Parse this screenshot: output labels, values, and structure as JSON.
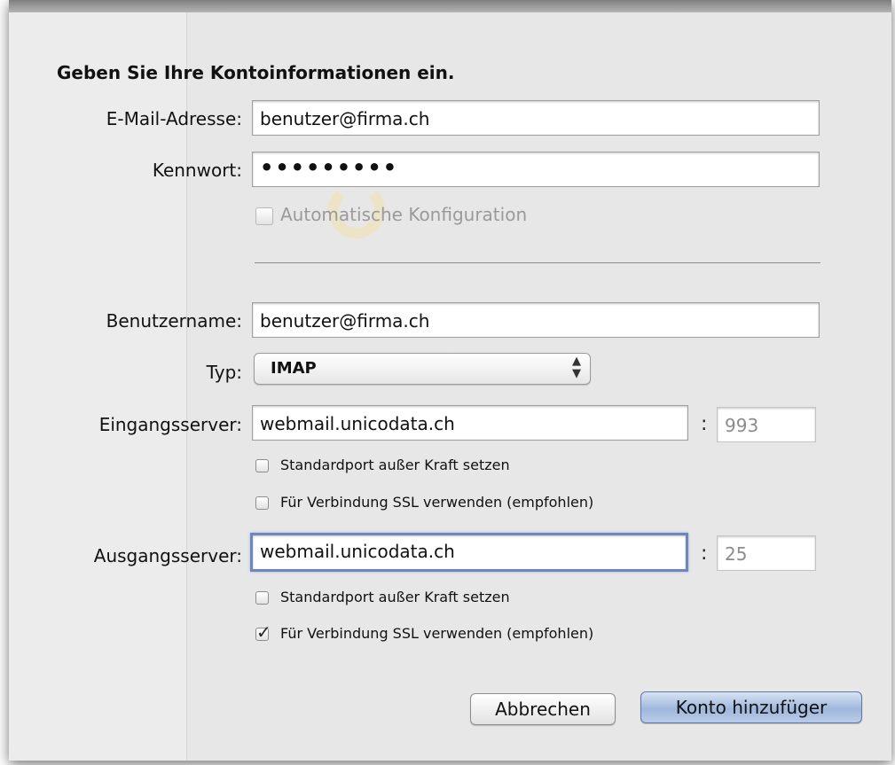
{
  "dialog": {
    "heading": "Geben Sie Ihre Kontoinformationen ein.",
    "email": {
      "label": "E-Mail-Adresse:",
      "value": "benutzer@firma.ch"
    },
    "password": {
      "label": "Kennwort:",
      "value": "•••••••••"
    },
    "auto_config": {
      "label": "Automatische Konfiguration",
      "checked": false,
      "enabled": false
    },
    "username": {
      "label": "Benutzername:",
      "value": "benutzer@firma.ch"
    },
    "type": {
      "label": "Typ:",
      "selected": "IMAP"
    },
    "incoming": {
      "label": "Eingangsserver:",
      "server": "webmail.unicodata.ch",
      "port": "993",
      "override_port": {
        "label": "Standardport außer Kraft setzen",
        "checked": false
      },
      "use_ssl": {
        "label": "Für Verbindung SSL verwenden (empfohlen)",
        "checked": false
      }
    },
    "outgoing": {
      "label": "Ausgangsserver:",
      "server": "webmail.unicodata.ch",
      "port": "25",
      "override_port": {
        "label": "Standardport außer Kraft setzen",
        "checked": false
      },
      "use_ssl": {
        "label": "Für Verbindung SSL verwenden (empfohlen)",
        "checked": true
      }
    },
    "port_separator": ":",
    "buttons": {
      "cancel": "Abbrechen",
      "add": "Konto hinzufüger"
    }
  },
  "colors": {
    "default_button": "#9fb7dc",
    "focus_ring": "#6e87b8"
  }
}
